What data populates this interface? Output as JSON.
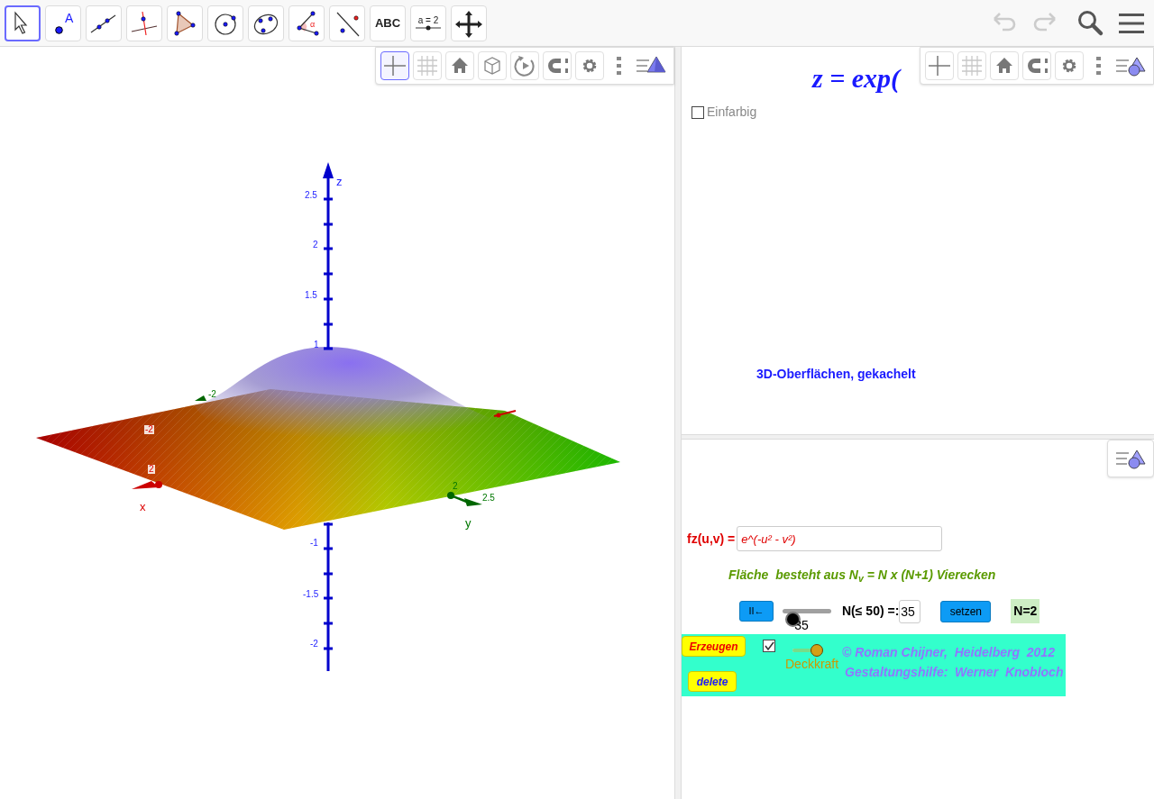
{
  "toolbar": {
    "tools": [
      {
        "kind": "pointer",
        "selected": true
      },
      {
        "kind": "point",
        "label": "A",
        "selected": false
      },
      {
        "kind": "line",
        "selected": false
      },
      {
        "kind": "perpendicular",
        "selected": false
      },
      {
        "kind": "polygon",
        "selected": false
      },
      {
        "kind": "circle",
        "selected": false
      },
      {
        "kind": "conic",
        "selected": false
      },
      {
        "kind": "angle",
        "label": "α",
        "selected": false
      },
      {
        "kind": "reflect",
        "selected": false
      },
      {
        "kind": "text",
        "label": "ABC",
        "selected": false
      },
      {
        "kind": "slider",
        "label": "a = 2",
        "selected": false
      },
      {
        "kind": "move",
        "selected": false
      }
    ],
    "actions": [
      {
        "kind": "undo",
        "disabled": true
      },
      {
        "kind": "redo",
        "disabled": true
      },
      {
        "kind": "search",
        "disabled": false
      },
      {
        "kind": "menu",
        "disabled": false
      }
    ]
  },
  "graphics_3d": {
    "style_bar": [
      {
        "kind": "axes",
        "selected": true
      },
      {
        "kind": "grid",
        "selected": false
      },
      {
        "kind": "home",
        "selected": false
      },
      {
        "kind": "cube",
        "selected": false
      },
      {
        "kind": "rotate",
        "selected": false
      },
      {
        "kind": "magnet",
        "selected": false
      },
      {
        "kind": "gear",
        "selected": false
      },
      {
        "kind": "dots"
      },
      {
        "kind": "pyramid"
      }
    ],
    "z_axis_labels": [
      "z",
      "2.5",
      "2",
      "1.5",
      "1",
      "-1",
      "-1.5",
      "-2"
    ],
    "x_axis_labels": [
      "x",
      "2",
      "-2"
    ],
    "y_axis_labels": [
      "y",
      "2.5",
      "2",
      "-2"
    ]
  },
  "graphics_top": {
    "style_bar": [
      {
        "kind": "axes",
        "selected": false
      },
      {
        "kind": "grid",
        "selected": false
      },
      {
        "kind": "home",
        "selected": false
      },
      {
        "kind": "magnet",
        "selected": false
      },
      {
        "kind": "gear",
        "selected": false
      },
      {
        "kind": "dots"
      },
      {
        "kind": "style2"
      }
    ],
    "formula": "z = exp(",
    "checkbox": {
      "label": "Einfarbig",
      "checked": false
    },
    "caption": "3D-Oberflächen, gekachelt"
  },
  "graphics_bottom": {
    "style_bar": [
      {
        "kind": "style2"
      }
    ],
    "function_label": "fz(u,v) =",
    "function_value": "e^(-u² - v²)",
    "note": "Fläche  besteht aus N$_{v}$ = N x (N+1) Vierecken",
    "reset_button": "II←",
    "n_slider": {
      "level": 0.2,
      "reading": "35"
    },
    "n_label": "N(≤ 50) =:",
    "n_value": "35",
    "set_button": "setzen",
    "n_result": "N=2",
    "create_button": "Erzeugen",
    "delete_button": "delete",
    "show_checkbox": {
      "checked": true
    },
    "opacity_slider": {
      "level": 0.95,
      "label": "Deckkraft"
    },
    "credits": [
      "© Roman Chijner,  Heidelberg  2012",
      "Gestaltungshilfe:  Werner  Knobloch"
    ]
  }
}
